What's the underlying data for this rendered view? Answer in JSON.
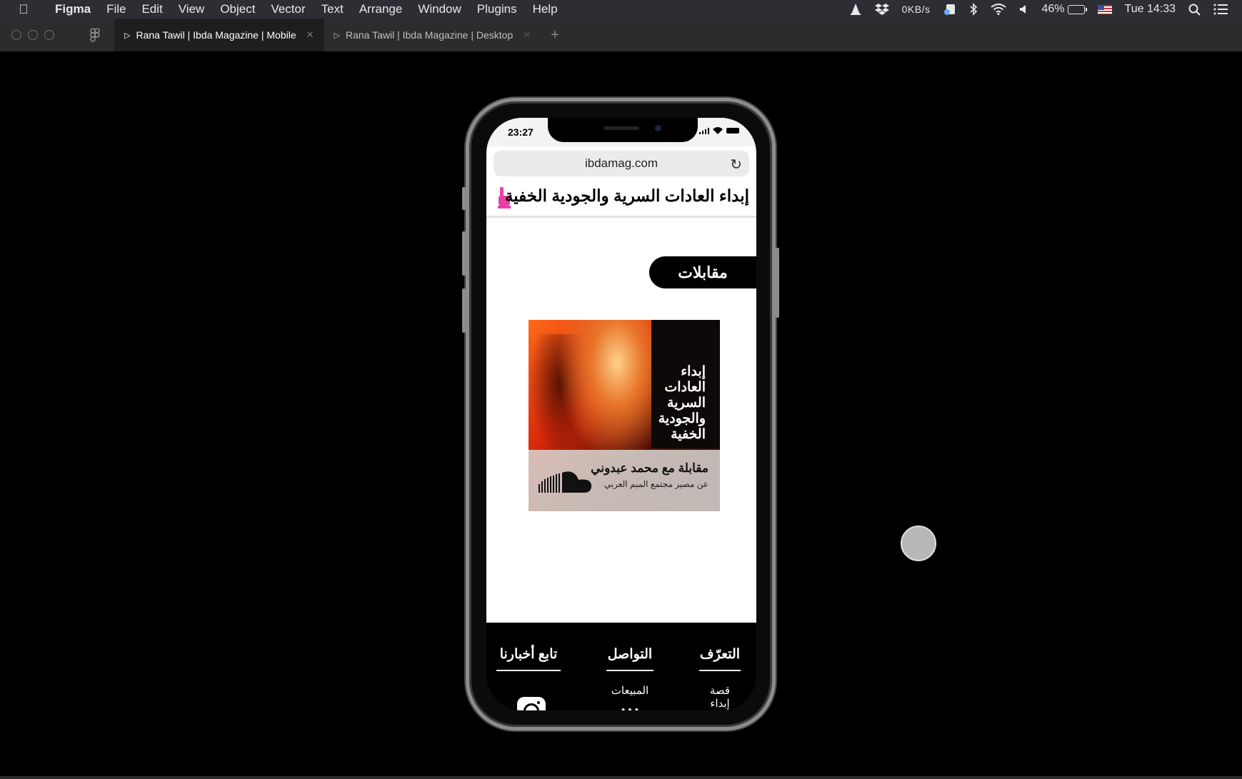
{
  "menubar": {
    "app_name": "Figma",
    "menus": [
      "File",
      "Edit",
      "View",
      "Object",
      "Vector",
      "Text",
      "Arrange",
      "Window",
      "Plugins",
      "Help"
    ],
    "network_speed": "0KB/s",
    "battery_percent": "46%",
    "clock": "Tue 14:33"
  },
  "tabs": [
    {
      "label": "Rana Tawil | Ibda Magazine | Mobile",
      "active": true
    },
    {
      "label": "Rana Tawil | Ibda Magazine | Desktop",
      "active": false
    }
  ],
  "phone": {
    "status_time": "23:27",
    "url": "ibdamag.com",
    "site_title": "إبداء العادات السرية والجودية الخفية",
    "section_label": "مقابلات",
    "card": {
      "poster_lines": [
        "إبداء",
        "العادات",
        "السرية",
        "والجودية",
        "الخفية"
      ],
      "title": "مقابلة مع محمد عبدوني",
      "subtitle": "عن مصير مجتمع الميم العربي"
    },
    "footer": {
      "col_about": {
        "title": "التعرّف",
        "link": "قصة إبداء"
      },
      "col_contact": {
        "title": "التواصل",
        "link": "المبيعات"
      },
      "col_follow": {
        "title": "تابع أخبارنا"
      }
    }
  },
  "colors": {
    "accent_pink": "#e83fa8",
    "canvas_bg": "#000000",
    "menubar_bg": "#2d2e33",
    "tabbar_bg": "#2c2c2c"
  }
}
